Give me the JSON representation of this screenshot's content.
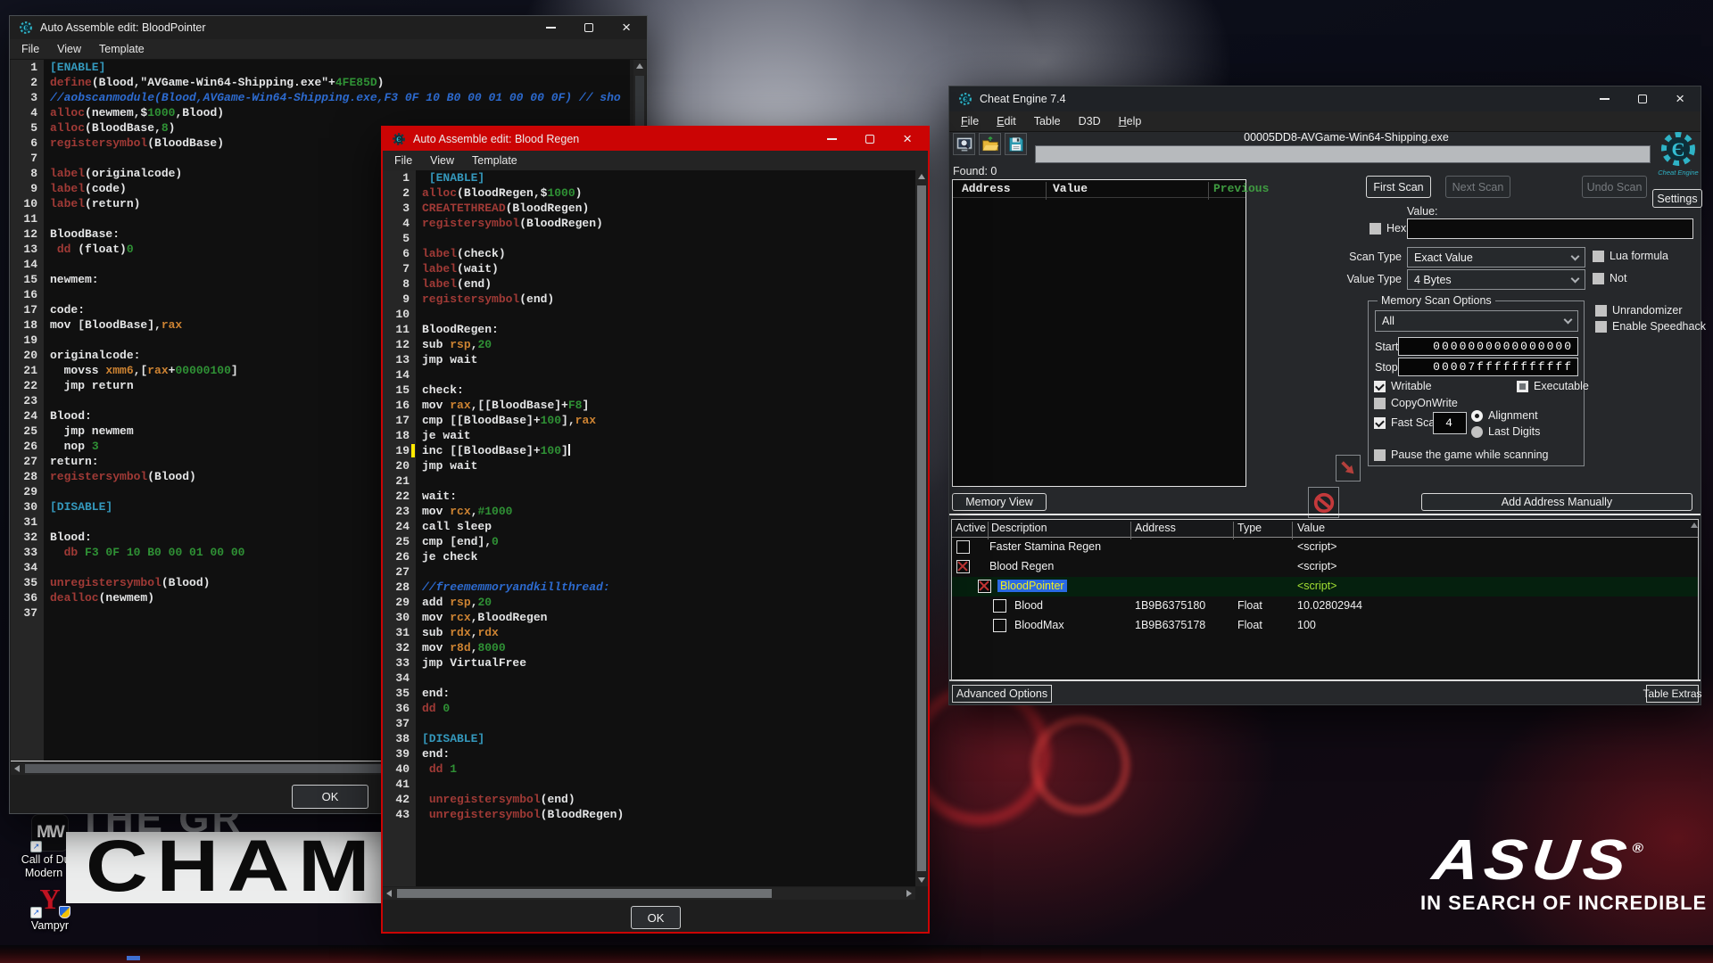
{
  "desktop": {
    "icons": [
      {
        "name": "call-of-duty",
        "glyph": "MW",
        "label_line1": "Call of Duty",
        "label_line2": "Modern ..."
      },
      {
        "name": "vampyr",
        "glyph": "Y",
        "label_line1": "Vampyr",
        "label_line2": ""
      }
    ],
    "wallpaper_back_text": "THE GR",
    "wallpaper_banner_text": "CHAMP",
    "asus_logo_text": "ASUS",
    "asus_reg_mark": "®",
    "asus_tagline": "IN SEARCH OF INCREDIBLE"
  },
  "bloodpointer_window": {
    "title": "Auto Assemble edit: BloodPointer",
    "menus": [
      "File",
      "View",
      "Template"
    ],
    "ok_label": "OK",
    "lines": [
      [
        [
          "[ENABLE]",
          "e"
        ]
      ],
      [
        [
          "define",
          "k"
        ],
        [
          "(Blood,\"AVGame-Win64-Shipping.exe\"+",
          "w"
        ],
        [
          "4FE85D",
          "g"
        ],
        [
          ")",
          "w"
        ]
      ],
      [
        [
          "//aobscanmodule(Blood,AVGame-Win64-Shipping.exe,F3 0F 10 B0 00 01 00 00 0F) // sho",
          "c"
        ]
      ],
      [
        [
          "alloc",
          "k"
        ],
        [
          "(newmem,$",
          "w"
        ],
        [
          "1000",
          "g"
        ],
        [
          ",Blood)",
          "w"
        ]
      ],
      [
        [
          "alloc",
          "k"
        ],
        [
          "(BloodBase,",
          "w"
        ],
        [
          "8",
          "g"
        ],
        [
          ")",
          "w"
        ]
      ],
      [
        [
          "registersymbol",
          "k"
        ],
        [
          "(BloodBase)",
          "w"
        ]
      ],
      [],
      [
        [
          "label",
          "k"
        ],
        [
          "(originalcode)",
          "w"
        ]
      ],
      [
        [
          "label",
          "k"
        ],
        [
          "(code)",
          "w"
        ]
      ],
      [
        [
          "label",
          "k"
        ],
        [
          "(return)",
          "w"
        ]
      ],
      [],
      [
        [
          "BloodBase:",
          "w"
        ]
      ],
      [
        [
          " ",
          "w"
        ],
        [
          "dd",
          "k"
        ],
        [
          " (float)",
          "w"
        ],
        [
          "0",
          "g"
        ]
      ],
      [],
      [
        [
          "newmem:",
          "w"
        ]
      ],
      [],
      [
        [
          "code:",
          "w"
        ]
      ],
      [
        [
          "mov [BloodBase],",
          "w"
        ],
        [
          "rax",
          "o"
        ]
      ],
      [],
      [
        [
          "originalcode:",
          "w"
        ]
      ],
      [
        [
          "  movss ",
          "w"
        ],
        [
          "xmm6",
          "o"
        ],
        [
          ",[",
          "w"
        ],
        [
          "rax",
          "o"
        ],
        [
          "+",
          "w"
        ],
        [
          "00000100",
          "g"
        ],
        [
          "]",
          "w"
        ]
      ],
      [
        [
          "  jmp return",
          "w"
        ]
      ],
      [],
      [
        [
          "Blood:",
          "w"
        ]
      ],
      [
        [
          "  jmp newmem",
          "w"
        ]
      ],
      [
        [
          "  nop ",
          "w"
        ],
        [
          "3",
          "g"
        ]
      ],
      [
        [
          "return:",
          "w"
        ]
      ],
      [
        [
          "registersymbol",
          "k"
        ],
        [
          "(Blood)",
          "w"
        ]
      ],
      [],
      [
        [
          "[DISABLE]",
          "e"
        ]
      ],
      [],
      [
        [
          "Blood:",
          "w"
        ]
      ],
      [
        [
          "  ",
          "w"
        ],
        [
          "db",
          "k"
        ],
        [
          " ",
          "w"
        ],
        [
          "F3 0F 10 B0 00 01 00 00",
          "g"
        ]
      ],
      [],
      [
        [
          "unregistersymbol",
          "k"
        ],
        [
          "(Blood)",
          "w"
        ]
      ],
      [
        [
          "dealloc",
          "k"
        ],
        [
          "(newmem)",
          "w"
        ]
      ],
      []
    ]
  },
  "bloodregen_window": {
    "title": "Auto Assemble edit: Blood Regen",
    "menus": [
      "File",
      "View",
      "Template"
    ],
    "ok_label": "OK",
    "cursor_line": 19,
    "lines": [
      [
        [
          " ",
          "w"
        ],
        [
          "[ENABLE]",
          "e"
        ]
      ],
      [
        [
          "alloc",
          "k"
        ],
        [
          "(BloodRegen,$",
          "w"
        ],
        [
          "1000",
          "g"
        ],
        [
          ")",
          "w"
        ]
      ],
      [
        [
          "CREATETHREAD",
          "k"
        ],
        [
          "(BloodRegen)",
          "w"
        ]
      ],
      [
        [
          "registersymbol",
          "k"
        ],
        [
          "(BloodRegen)",
          "w"
        ]
      ],
      [],
      [
        [
          "label",
          "k"
        ],
        [
          "(check)",
          "w"
        ]
      ],
      [
        [
          "label",
          "k"
        ],
        [
          "(wait)",
          "w"
        ]
      ],
      [
        [
          "label",
          "k"
        ],
        [
          "(end)",
          "w"
        ]
      ],
      [
        [
          "registersymbol",
          "k"
        ],
        [
          "(end)",
          "w"
        ]
      ],
      [],
      [
        [
          "BloodRegen:",
          "w"
        ]
      ],
      [
        [
          "sub ",
          "w"
        ],
        [
          "rsp",
          "o"
        ],
        [
          ",",
          "w"
        ],
        [
          "20",
          "g"
        ]
      ],
      [
        [
          "jmp wait",
          "w"
        ]
      ],
      [],
      [
        [
          "check:",
          "w"
        ]
      ],
      [
        [
          "mov ",
          "w"
        ],
        [
          "rax",
          "o"
        ],
        [
          ",[[BloodBase]+",
          "w"
        ],
        [
          "F8",
          "g"
        ],
        [
          "]",
          "w"
        ]
      ],
      [
        [
          "cmp [[BloodBase]+",
          "w"
        ],
        [
          "100",
          "g"
        ],
        [
          "],",
          "w"
        ],
        [
          "rax",
          "o"
        ]
      ],
      [
        [
          "je wait",
          "w"
        ]
      ],
      [
        [
          "inc [[BloodBase]+",
          "w"
        ],
        [
          "100",
          "g"
        ],
        [
          "]",
          "w"
        ]
      ],
      [
        [
          "jmp wait",
          "w"
        ]
      ],
      [],
      [
        [
          "wait:",
          "w"
        ]
      ],
      [
        [
          "mov ",
          "w"
        ],
        [
          "rcx",
          "o"
        ],
        [
          ",",
          "w"
        ],
        [
          "#1000",
          "g"
        ]
      ],
      [
        [
          "call sleep",
          "w"
        ]
      ],
      [
        [
          "cmp [end],",
          "w"
        ],
        [
          "0",
          "g"
        ]
      ],
      [
        [
          "je check",
          "w"
        ]
      ],
      [],
      [
        [
          "//freememmoryandkillthread:",
          "c"
        ]
      ],
      [
        [
          "add ",
          "w"
        ],
        [
          "rsp",
          "o"
        ],
        [
          ",",
          "w"
        ],
        [
          "20",
          "g"
        ]
      ],
      [
        [
          "mov ",
          "w"
        ],
        [
          "rcx",
          "o"
        ],
        [
          ",BloodRegen",
          "w"
        ]
      ],
      [
        [
          "sub ",
          "w"
        ],
        [
          "rdx",
          "o"
        ],
        [
          ",",
          "w"
        ],
        [
          "rdx",
          "o"
        ]
      ],
      [
        [
          "mov ",
          "w"
        ],
        [
          "r8d",
          "o"
        ],
        [
          ",",
          "w"
        ],
        [
          "8000",
          "g"
        ]
      ],
      [
        [
          "jmp VirtualFree",
          "w"
        ]
      ],
      [],
      [
        [
          "end:",
          "w"
        ]
      ],
      [
        [
          "dd",
          "k"
        ],
        [
          " ",
          "w"
        ],
        [
          "0",
          "g"
        ]
      ],
      [],
      [
        [
          "[DISABLE]",
          "e"
        ]
      ],
      [
        [
          "end:",
          "w"
        ]
      ],
      [
        [
          " ",
          "w"
        ],
        [
          "dd",
          "k"
        ],
        [
          " ",
          "w"
        ],
        [
          "1",
          "g"
        ]
      ],
      [],
      [
        [
          " ",
          "w"
        ],
        [
          "unregistersymbol",
          "k"
        ],
        [
          "(end)",
          "w"
        ]
      ],
      [
        [
          " ",
          "w"
        ],
        [
          "unregistersymbol",
          "k"
        ],
        [
          "(BloodRegen)",
          "w"
        ]
      ]
    ]
  },
  "cheat_engine": {
    "title": "Cheat Engine 7.4",
    "menus": [
      "File",
      "Edit",
      "Table",
      "D3D",
      "Help"
    ],
    "menu_accels": [
      true,
      true,
      false,
      false,
      true
    ],
    "process": "00005DD8-AVGame-Win64-Shipping.exe",
    "logo_label": "Cheat Engine",
    "settings_label": "Settings",
    "found_label": "Found: 0",
    "found_columns": [
      "Address",
      "Value",
      "Previous"
    ],
    "first_scan_label": "First Scan",
    "next_scan_label": "Next Scan",
    "undo_scan_label": "Undo Scan",
    "value_label": "Value:",
    "hex_label": "Hex",
    "scan_type_label": "Scan Type",
    "scan_type_value": "Exact Value",
    "value_type_label": "Value Type",
    "value_type_value": "4 Bytes",
    "lua_formula_label": "Lua formula",
    "not_label": "Not",
    "memory_scan_options_label": "Memory Scan Options",
    "region_value": "All",
    "start_label": "Start",
    "start_value": "0000000000000000",
    "stop_label": "Stop",
    "stop_value": "00007fffffffffff",
    "writable_label": "Writable",
    "executable_label": "Executable",
    "copyonwrite_label": "CopyOnWrite",
    "fast_scan_label": "Fast Scan",
    "fast_scan_value": "4",
    "alignment_label": "Alignment",
    "last_digits_label": "Last Digits",
    "pause_label": "Pause the game while scanning",
    "unrandomizer_label": "Unrandomizer",
    "speedhack_label": "Enable Speedhack",
    "memory_view_label": "Memory View",
    "add_address_label": "Add Address Manually",
    "advanced_options_label": "Advanced Options",
    "table_extras_label": "Table Extras",
    "table_columns": [
      "Active",
      "Description",
      "Address",
      "Type",
      "Value"
    ],
    "table_rows": [
      {
        "check": "empty",
        "indent": 0,
        "description": "Faster Stamina Regen",
        "address": "",
        "type": "",
        "value": "<script>",
        "selected": false
      },
      {
        "check": "redx",
        "indent": 0,
        "description": "Blood Regen",
        "address": "",
        "type": "",
        "value": "<script>",
        "selected": false
      },
      {
        "check": "redx",
        "indent": 1,
        "description": "BloodPointer",
        "address": "",
        "type": "",
        "value": "<script>",
        "selected": true
      },
      {
        "check": "empty",
        "indent": 2,
        "description": "Blood",
        "address": "1B9B6375180",
        "type": "Float",
        "value": "10.02802944",
        "selected": false
      },
      {
        "check": "empty",
        "indent": 2,
        "description": "BloodMax",
        "address": "1B9B6375178",
        "type": "Float",
        "value": "100",
        "selected": false
      }
    ]
  }
}
